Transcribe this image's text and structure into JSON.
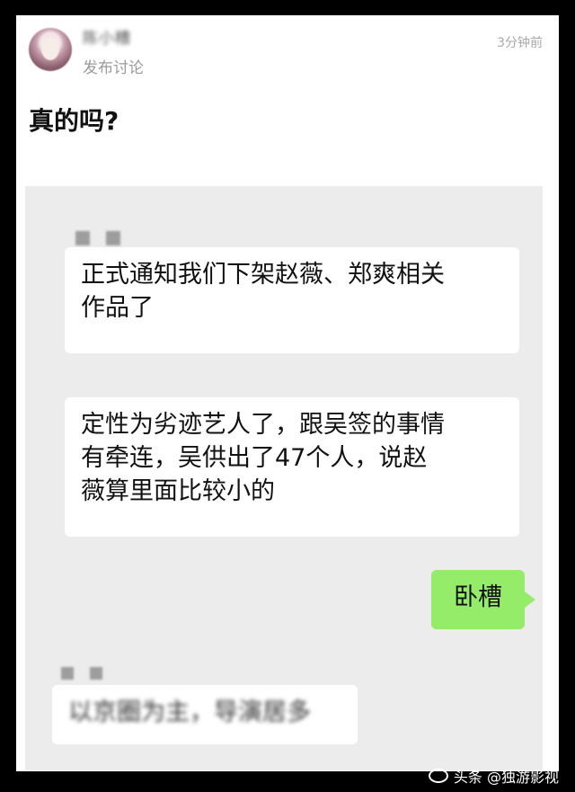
{
  "post": {
    "username": "陈小糟",
    "subtitle": "发布讨论",
    "time": "3分钟前",
    "title": "真的吗?"
  },
  "chat": {
    "message1": "正式通知我们下架赵薇、郑爽相关\n作品了",
    "message2": "定性为劣迹艺人了，跟吴签的事情\n有牵连，吴供出了47个人，说赵\n薇算里面比较小的",
    "reply": "卧槽",
    "message3": "以京圈为主，导演居多"
  },
  "watermark": {
    "text": "头条 @独游影视"
  },
  "icons": [
    "avatar",
    "weibo-icon"
  ]
}
